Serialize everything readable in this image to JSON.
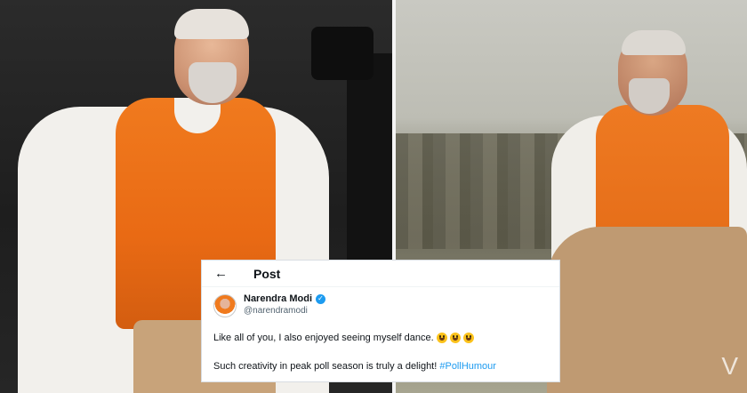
{
  "tweet": {
    "header_title": "Post",
    "back_glyph": "←",
    "author_name": "Narendra Modi",
    "author_handle": "@narendramodi",
    "verified_icon": "verified-badge-icon",
    "line1": "Like all of you, I also enjoyed seeing myself dance.",
    "emojis": [
      "😃",
      "😃",
      "😃"
    ],
    "line2_text": "Such creativity in peak poll season is truly a delight! ",
    "hashtag": "#PollHumour"
  },
  "watermark": "V",
  "colors": {
    "accent": "#1d9bf0",
    "vest": "#e96a14",
    "text": "#0f1419",
    "muted": "#536471"
  }
}
